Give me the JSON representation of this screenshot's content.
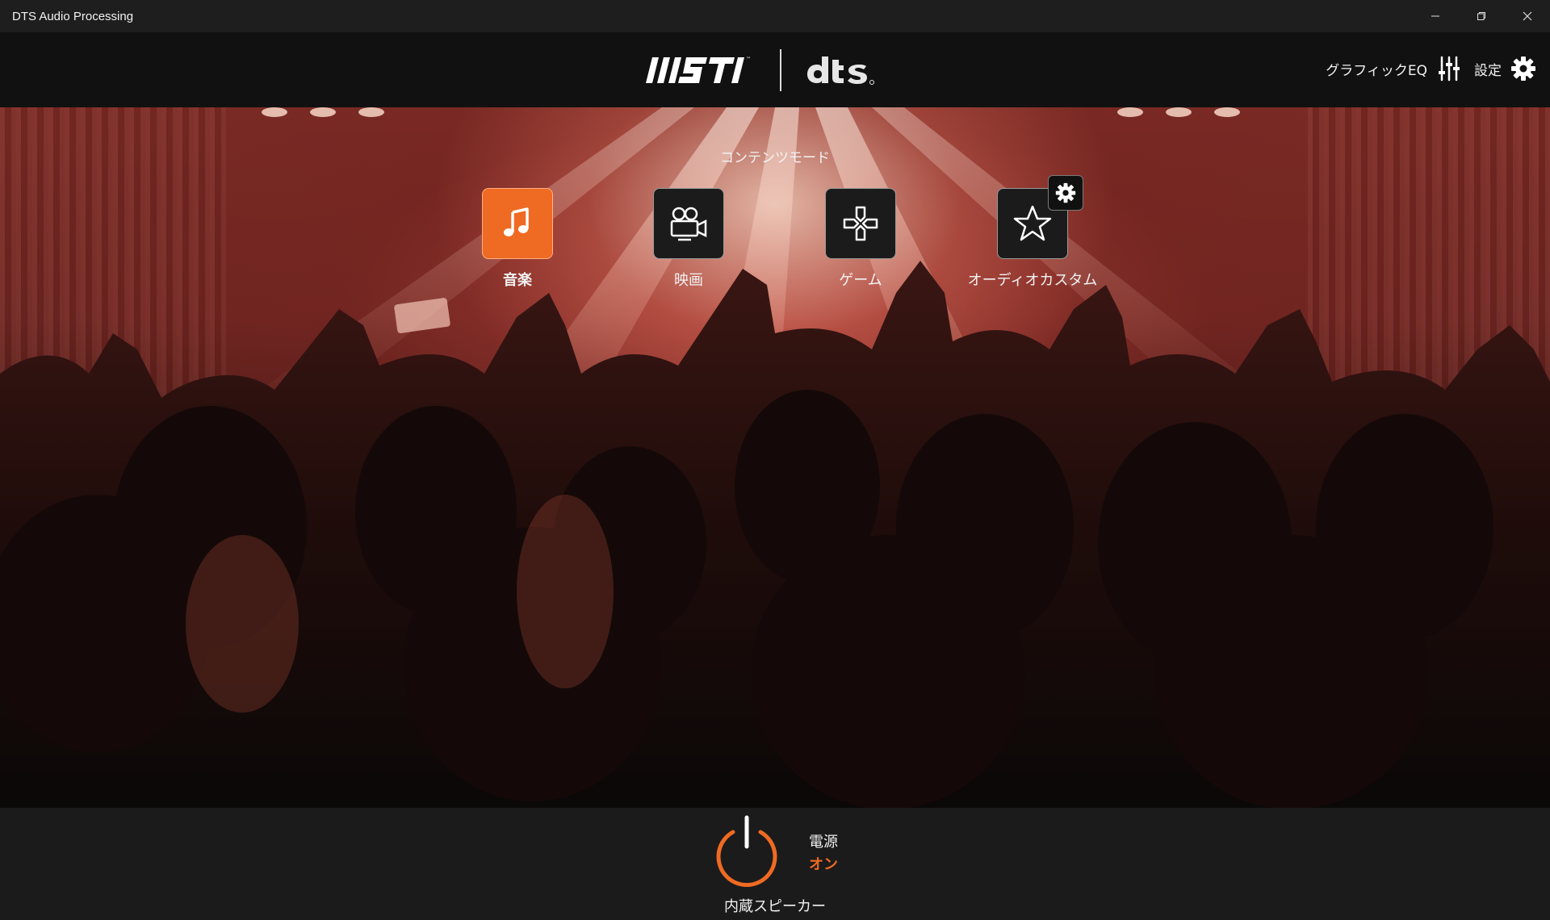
{
  "window": {
    "title": "DTS Audio Processing"
  },
  "header": {
    "graphic_eq_label": "グラフィックEQ",
    "settings_label": "設定"
  },
  "content_mode": {
    "title": "コンテンツモード",
    "modes": [
      {
        "label": "音楽",
        "icon": "music-note-icon",
        "active": true
      },
      {
        "label": "映画",
        "icon": "movie-camera-icon",
        "active": false
      },
      {
        "label": "ゲーム",
        "icon": "gamepad-icon",
        "active": false
      },
      {
        "label": "オーディオカスタム",
        "icon": "star-icon",
        "active": false
      }
    ]
  },
  "footer": {
    "power_label": "電源",
    "power_state": "オン",
    "device_label": "内蔵スピーカー"
  },
  "colors": {
    "accent": "#ef6a22",
    "titlebar": "#1e1e1e",
    "header": "#111111",
    "footer": "#1b1b1b"
  }
}
